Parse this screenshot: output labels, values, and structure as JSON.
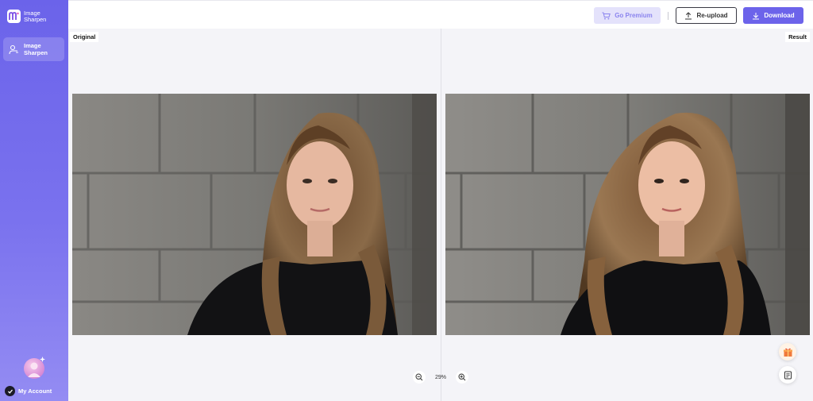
{
  "app": {
    "logo_text": "Image Sharpen"
  },
  "sidebar": {
    "items": [
      {
        "label": "Image Sharpen",
        "icon": "sharpen-icon",
        "active": true
      }
    ],
    "account_label": "My Account"
  },
  "toolbar": {
    "premium_label": "Go Premium",
    "reupload_label": "Re-upload",
    "download_label": "Download"
  },
  "panels": {
    "original_label": "Original",
    "result_label": "Result"
  },
  "zoom": {
    "value": "29%"
  },
  "colors": {
    "accent": "#6c63ea",
    "premium_bg": "#e4e2fb",
    "sidebar_top": "#6b63ea",
    "sidebar_bottom": "#948cf3"
  }
}
